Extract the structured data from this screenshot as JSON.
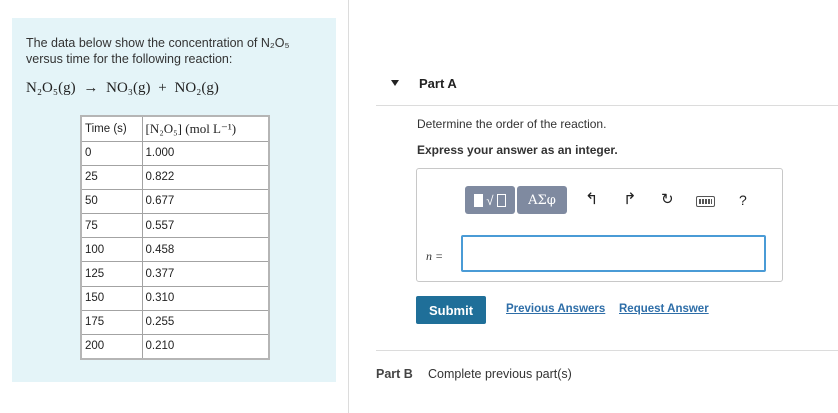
{
  "problem": {
    "intro": "The data below show the concentration of N₂O₅ versus time for the following reaction:",
    "reaction": {
      "reactant": "N₂O₅(g)",
      "arrow": "→",
      "product1": "NO₃(g)",
      "plus": "+",
      "product2": "NO₂(g)"
    },
    "table": {
      "headers": [
        "Time (s)",
        "[N₂O₅] (mol L⁻¹)"
      ],
      "rows": [
        [
          "0",
          "1.000"
        ],
        [
          "25",
          "0.822"
        ],
        [
          "50",
          "0.677"
        ],
        [
          "75",
          "0.557"
        ],
        [
          "100",
          "0.458"
        ],
        [
          "125",
          "0.377"
        ],
        [
          "150",
          "0.310"
        ],
        [
          "175",
          "0.255"
        ],
        [
          "200",
          "0.210"
        ]
      ]
    }
  },
  "partA": {
    "title": "Part A",
    "question": "Determine the order of the reaction.",
    "instruction": "Express your answer as an integer.",
    "toolbar": {
      "greek_label": "ΑΣφ",
      "undo_glyph": "↰",
      "redo_glyph": "↱",
      "reset_glyph": "↻",
      "help_glyph": "?"
    },
    "variable_label": "n =",
    "input_value": "",
    "submit_label": "Submit",
    "previous_answers_label": "Previous Answers",
    "request_answer_label": "Request Answer"
  },
  "partB": {
    "title": "Part B",
    "status": "Complete previous part(s)"
  },
  "colors": {
    "panel_bg": "#e4f4f8",
    "submit_bg": "#1f6f99",
    "link": "#2e6ea8",
    "input_border": "#4a9bd6",
    "toolbar_btn": "#7f8aa0"
  }
}
